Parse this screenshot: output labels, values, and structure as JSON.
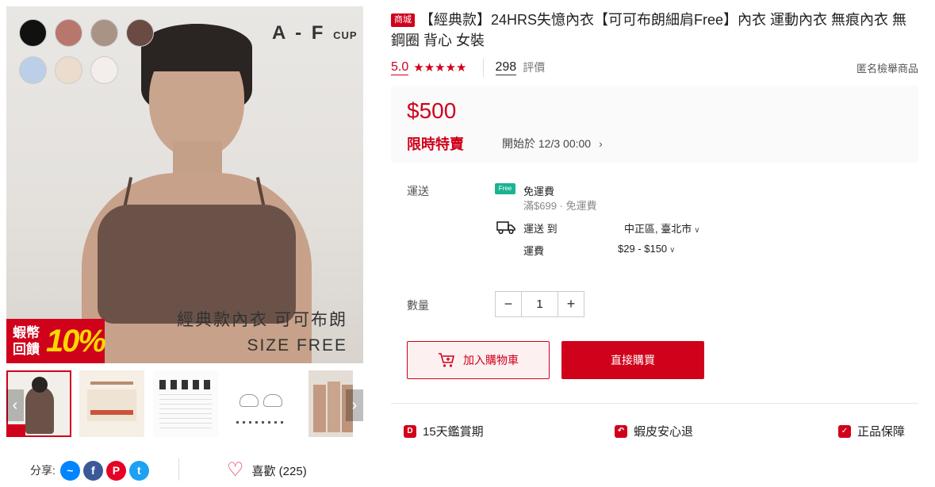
{
  "gallery": {
    "swatches": [
      "#111111",
      "#b8776d",
      "#a99387",
      "#6a4b44",
      "#bccfe8",
      "#ecdccd",
      "#f3eeec"
    ],
    "cup_label": "A - F",
    "cup_suffix": "CUP",
    "caption_line1": "經典款內衣 可可布朗",
    "caption_line2": "SIZE  FREE",
    "coin_badge_text": "蝦幣回饋",
    "coin_badge_pct": "10%",
    "thumb_prev_icon": "chevron-left-icon",
    "thumb_next_icon": "chevron-right-icon"
  },
  "share": {
    "label": "分享:",
    "icons": [
      "messenger-icon",
      "facebook-icon",
      "pinterest-icon",
      "twitter-icon"
    ]
  },
  "like": {
    "label": "喜歡 (225)"
  },
  "product": {
    "mall_badge": "商城",
    "title": "【經典款】24HRS失憶內衣【可可布朗細肩Free】內衣 運動內衣 無痕內衣 無鋼圈 背心 女裝",
    "rating": "5.0",
    "stars": "★★★★★",
    "review_count": "298",
    "review_label": "評價",
    "anon_report": "匿名檢舉商品"
  },
  "price": {
    "value": "$500",
    "flash_label": "限時特賣",
    "flash_start": "開始於 12/3 00:00"
  },
  "shipping": {
    "label": "運送",
    "free_icon_text": "Free",
    "free_title": "免運費",
    "free_sub": "滿$699 · 免運費",
    "to_label": "運送 到",
    "destination": "中正區, 臺北市",
    "fee_label": "運費",
    "fee_range": "$29 - $150"
  },
  "quantity": {
    "label": "數量",
    "value": "1"
  },
  "actions": {
    "add_to_cart": "加入購物車",
    "buy_now": "直接購買"
  },
  "guarantees": [
    {
      "label": "15天鑑賞期"
    },
    {
      "label": "蝦皮安心退"
    },
    {
      "label": "正品保障"
    }
  ],
  "colors": {
    "accent": "#d0011b"
  }
}
